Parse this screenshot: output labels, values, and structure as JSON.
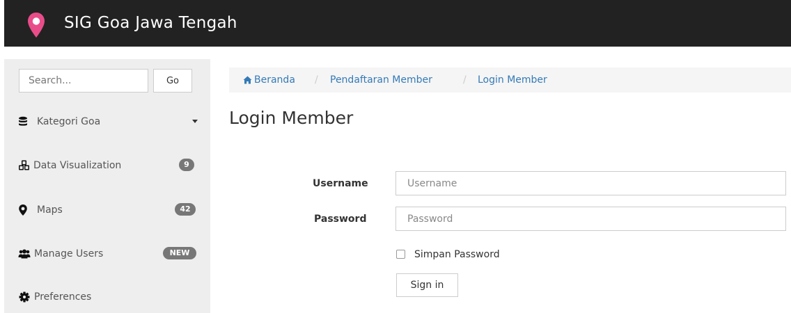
{
  "navbar": {
    "brand": "SIG Goa Jawa Tengah",
    "brand_icon": "map-marker-icon",
    "brand_icon_color": "#e84d8a"
  },
  "sidebar": {
    "search_placeholder": "Search...",
    "go_label": "Go",
    "items": [
      {
        "label": "Kategori Goa",
        "icon": "database-icon",
        "badge": ""
      },
      {
        "label": "Data Visualization",
        "icon": "cubes-icon",
        "badge": "9"
      },
      {
        "label": "Maps",
        "icon": "map-marker-icon",
        "badge": "42"
      },
      {
        "label": "Manage Users",
        "icon": "users-icon",
        "badge": "NEW"
      },
      {
        "label": "Preferences",
        "icon": "gear-icon",
        "badge": ""
      }
    ]
  },
  "breadcrumb": {
    "items": [
      "Beranda",
      "Pendaftaran Member",
      "Login Member"
    ],
    "separator": "/",
    "link_color": "#337ab7"
  },
  "page": {
    "title": "Login Member"
  },
  "form": {
    "username_label": "Username",
    "username_placeholder": "Username",
    "username_value": "",
    "password_label": "Password",
    "password_placeholder": "Password",
    "password_value": "",
    "remember_label": "Simpan Password",
    "remember_checked": false,
    "submit_label": "Sign in"
  }
}
